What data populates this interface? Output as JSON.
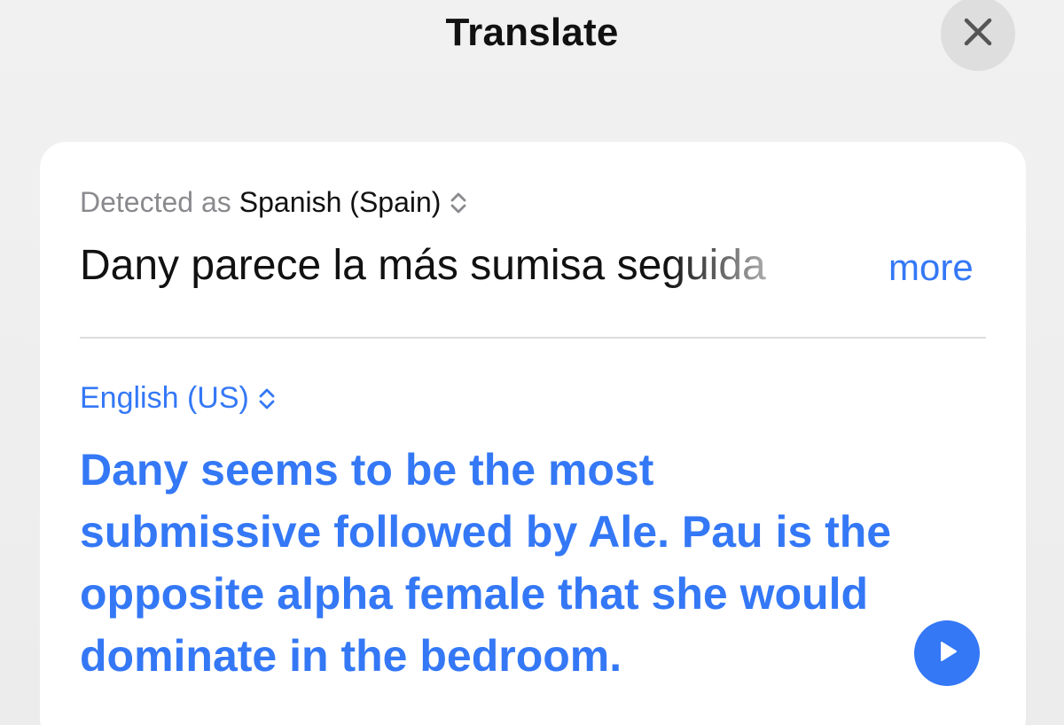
{
  "header": {
    "title": "Translate",
    "close_icon": "close-icon"
  },
  "source": {
    "detected_prefix": "Detected as",
    "language": "Spanish (Spain)",
    "selector_icon": "chevron-up-down-icon",
    "text": "Dany parece la más sumisa seguida",
    "more_label": "more"
  },
  "target": {
    "language": "English (US)",
    "selector_icon": "chevron-up-down-icon",
    "translation": "Dany seems to be the most submissive followed by Ale. Pau is the opposite alpha female that she would dominate in the bedroom.",
    "play_icon": "play-icon"
  },
  "colors": {
    "accent": "#3478f6",
    "background": "#efefef",
    "card": "#ffffff",
    "primary_text": "#111111",
    "secondary_text": "#8a8a8e"
  }
}
